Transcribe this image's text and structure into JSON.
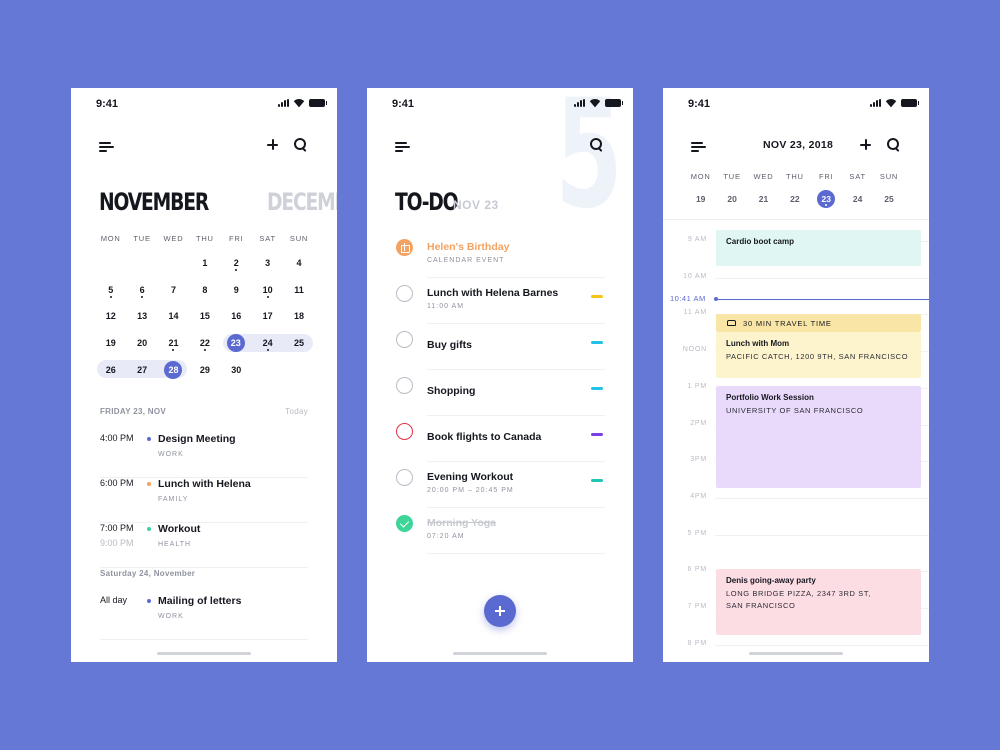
{
  "status_time": "9:41",
  "phone1": {
    "month_current": "NOVEMBER",
    "month_next": "DECEMB",
    "weekdays": [
      "MON",
      "TUE",
      "WED",
      "THU",
      "FRI",
      "SAT",
      "SUN"
    ],
    "weeks": [
      [
        {
          "d": ""
        },
        {
          "d": ""
        },
        {
          "d": ""
        },
        {
          "d": "1"
        },
        {
          "d": "2",
          "dot": true
        },
        {
          "d": "3"
        },
        {
          "d": "4"
        }
      ],
      [
        {
          "d": "5",
          "dot": true
        },
        {
          "d": "6",
          "dot": true
        },
        {
          "d": "7"
        },
        {
          "d": "8"
        },
        {
          "d": "9"
        },
        {
          "d": "10",
          "dot": true
        },
        {
          "d": "11"
        }
      ],
      [
        {
          "d": "12"
        },
        {
          "d": "13"
        },
        {
          "d": "14"
        },
        {
          "d": "15"
        },
        {
          "d": "16"
        },
        {
          "d": "17"
        },
        {
          "d": "18"
        }
      ],
      [
        {
          "d": "19"
        },
        {
          "d": "20"
        },
        {
          "d": "21",
          "dot": true
        },
        {
          "d": "22",
          "dot": true
        },
        {
          "d": "23",
          "dot": true,
          "sel": true
        },
        {
          "d": "24",
          "dot": true
        },
        {
          "d": "25"
        }
      ],
      [
        {
          "d": "26"
        },
        {
          "d": "27"
        },
        {
          "d": "28",
          "sel": true
        },
        {
          "d": "29"
        },
        {
          "d": "30"
        },
        {
          "d": ""
        },
        {
          "d": ""
        }
      ]
    ],
    "section1_title": "FRIDAY 23, NOV",
    "section1_right": "Today",
    "events1": [
      {
        "t1": "4:00 PM",
        "t2": "",
        "title": "Design Meeting",
        "sub": "WORK",
        "color": "#5b6ad0"
      },
      {
        "t1": "6:00 PM",
        "t2": "",
        "title": "Lunch with Helena",
        "sub": "FAMILY",
        "color": "#f4a261"
      },
      {
        "t1": "7:00 PM",
        "t2": "9:00 PM",
        "title": "Workout",
        "sub": "HEALTH",
        "color": "#3dd598"
      }
    ],
    "section2_title": "Saturday 24, November",
    "events2": [
      {
        "t1": "All day",
        "t2": "",
        "title": "Mailing of letters",
        "sub": "WORK",
        "color": "#5b6ad0"
      }
    ]
  },
  "phone2": {
    "big_number": "5",
    "title": "TO-DO",
    "date": "NOV 23",
    "tasks": [
      {
        "title": "Helen's Birthday",
        "sub": "CALENDAR EVENT",
        "kind": "gift",
        "tag": ""
      },
      {
        "title": "Lunch with Helena Barnes",
        "sub": "11:00 AM",
        "kind": "open",
        "tag": "#f5c518"
      },
      {
        "title": "Buy gifts",
        "sub": "",
        "kind": "open",
        "tag": "#22c1e6"
      },
      {
        "title": "Shopping",
        "sub": "",
        "kind": "open",
        "tag": "#22c1e6"
      },
      {
        "title": "Book flights to Canada",
        "sub": "",
        "kind": "red",
        "tag": "#7b3fe4"
      },
      {
        "title": "Evening Workout",
        "sub": "20:00 PM – 20:45 PM",
        "kind": "open",
        "tag": "#1fc7b3"
      },
      {
        "title": "Morning Yoga",
        "sub": "07:20 AM",
        "kind": "done",
        "tag": ""
      }
    ]
  },
  "phone3": {
    "date": "NOV 23, 2018",
    "week": [
      {
        "l": "MON",
        "n": "19"
      },
      {
        "l": "TUE",
        "n": "20"
      },
      {
        "l": "WED",
        "n": "21"
      },
      {
        "l": "THU",
        "n": "22"
      },
      {
        "l": "FRI",
        "n": "23",
        "sel": true
      },
      {
        "l": "SAT",
        "n": "24"
      },
      {
        "l": "SUN",
        "n": "25"
      }
    ],
    "hours": [
      "9 AM",
      "10 AM",
      "11 AM",
      "NOON",
      "1 PM",
      "2PM",
      "3PM",
      "4PM",
      "5 PM",
      "6 PM",
      "7 PM",
      "8 PM"
    ],
    "now_label": "10:41 AM",
    "travel_label": "30 MIN TRAVEL TIME",
    "events": [
      {
        "title": "Cardio boot camp",
        "sub": "",
        "color": "#dff6f2"
      },
      {
        "title": "Lunch with Mom",
        "sub": "PACIFIC CATCH, 1200 9TH, SAN FRANCISCO",
        "color": "#fdf3cc"
      },
      {
        "title": "Portfolio Work Session",
        "sub": "UNIVERSITY OF SAN FRANCISCO",
        "color": "#e9d9fb"
      },
      {
        "title": "Denis going-away party",
        "sub1": "LONG BRIDGE PIZZA, 2347 3RD ST,",
        "sub2": "SAN FRANCISCO",
        "color": "#fddde4"
      }
    ]
  }
}
